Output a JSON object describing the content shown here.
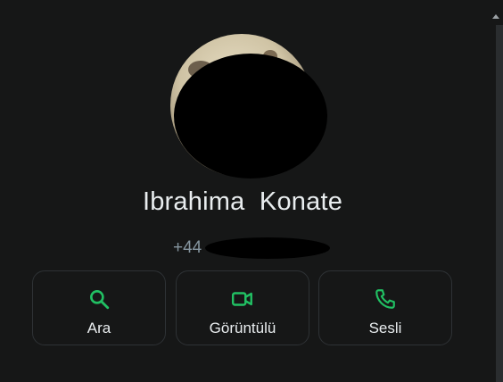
{
  "contact": {
    "name": "Ibrahima  Konate",
    "phone_prefix": "+44"
  },
  "actions": {
    "search_label": "Ara",
    "video_label": "Görüntülü",
    "voice_label": "Sesli"
  },
  "colors": {
    "background": "#161717",
    "accent": "#21c063",
    "text": "#e9edef",
    "muted": "#8696a0"
  },
  "icons": {
    "search": "search-icon",
    "video": "video-camera-icon",
    "voice": "phone-icon"
  }
}
